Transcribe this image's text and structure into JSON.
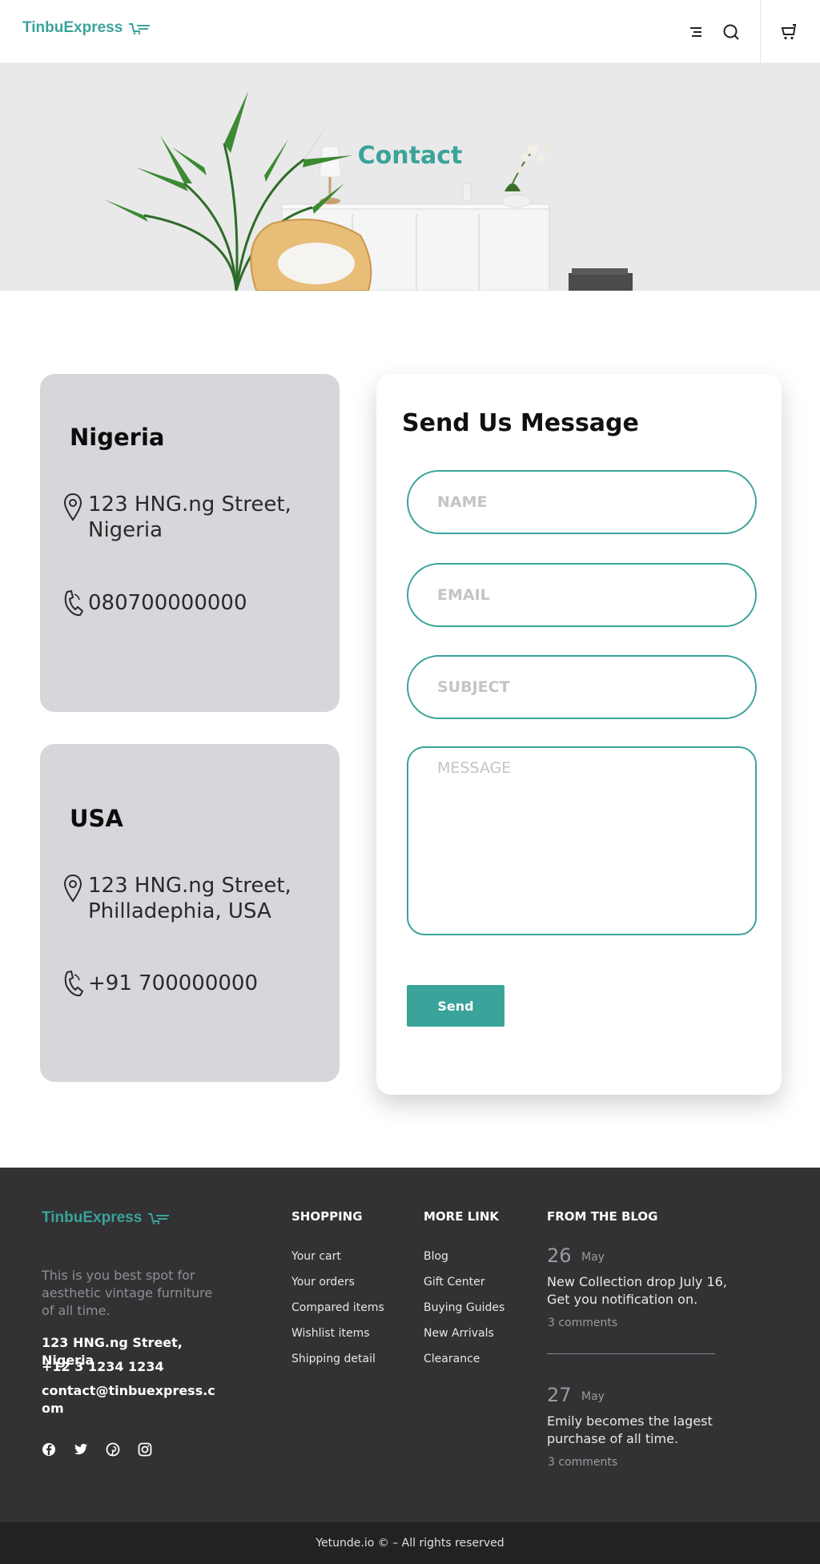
{
  "header": {
    "logo_text": "TinbuExpress",
    "icons": [
      "menu-icon",
      "search-icon",
      "cart-icon"
    ]
  },
  "hero": {
    "title": "Contact"
  },
  "locations": [
    {
      "country": "Nigeria",
      "address": "123 HNG.ng Street, Nigeria",
      "phone": "080700000000"
    },
    {
      "country": "USA",
      "address": "123 HNG.ng Street, Philladephia, USA",
      "phone": "+91 700000000"
    }
  ],
  "form": {
    "title": "Send Us Message",
    "name_placeholder": "NAME",
    "email_placeholder": "EMAIL",
    "subject_placeholder": "SUBJECT",
    "message_placeholder": "MESSAGE",
    "send_label": "Send"
  },
  "footer": {
    "logo_text": "TinbuExpress",
    "description": "This is you best spot for aesthetic vintage furniture of all time.",
    "address": "123 HNG.ng Street, Nigeria",
    "phone": "+12 3 1234 1234",
    "email": "contact@tinbuexpress.com",
    "social_icons": [
      "facebook-icon",
      "twitter-icon",
      "pinterest-icon",
      "instagram-icon"
    ],
    "shopping": {
      "title": "SHOPPING",
      "links": [
        "Your cart",
        "Your orders",
        "Compared items",
        "Wishlist items",
        "Shipping detail"
      ]
    },
    "more_link": {
      "title": "MORE LINK",
      "links": [
        "Blog",
        "Gift Center",
        "Buying Guides",
        "New Arrivals",
        "Clearance"
      ]
    },
    "blog": {
      "title": "FROM THE BLOG",
      "posts": [
        {
          "day": "26",
          "month": "May",
          "title": "New Collection drop July 16, Get you notification on.",
          "comments": "3 comments"
        },
        {
          "day": "27",
          "month": "May",
          "title": "Emily becomes the lagest purchase of all time.",
          "comments": "3 comments"
        }
      ]
    },
    "copyright": "Yetunde.io © – All rights reserved"
  },
  "colors": {
    "accent": "#3aa39a",
    "card_bg": "#d7d6db",
    "footer_bg": "#323234",
    "bottom_bar_bg": "#222224"
  }
}
